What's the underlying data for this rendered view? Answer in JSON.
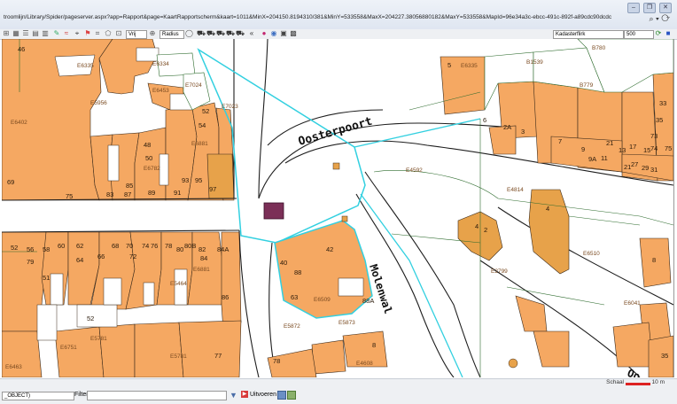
{
  "browser": {
    "url": "troomlijn/Library/Spider/pageserver.aspx?app=Rapport&page=KaartRapportscherm&kaart=1011&MinX=204150.8194310/381&MinY=533558&MaxX=204227.38056880182&MaxY=533558&MapId=96e34a3c-ebcc-491c-892f-a89cdc90dcdc",
    "nav_symbols": "⌕ ▾ ⟳"
  },
  "toolbar": {
    "select_vrij": "Vrij",
    "select_radius": "Radius",
    "select_layer": "Kadasterflirk",
    "select_scale": "500"
  },
  "map": {
    "street_names": [
      "Oosterpoort",
      "Molenwal",
      "Oo"
    ],
    "house_numbers": [
      "46",
      "69",
      "75",
      "83",
      "87",
      "85",
      "89",
      "91",
      "93",
      "95",
      "97",
      "48",
      "50",
      "52",
      "54",
      "56",
      "58",
      "60",
      "62",
      "64",
      "66",
      "68",
      "70",
      "72",
      "74",
      "76",
      "78",
      "80",
      "80B",
      "82",
      "84",
      "84A",
      "86",
      "63",
      "40",
      "42",
      "88",
      "88A",
      "8",
      "4",
      "2",
      "2A",
      "3",
      "5",
      "6",
      "7",
      "9",
      "9A",
      "11",
      "13",
      "15",
      "17",
      "21",
      "27",
      "29",
      "31",
      "33",
      "35",
      "73",
      "74",
      "75",
      "77",
      "78",
      "79",
      "51",
      "52",
      "56A",
      "58A",
      "E7097"
    ],
    "parcel_ids": [
      "E6334",
      "E6335",
      "E6402",
      "E5956",
      "E7024",
      "E7023",
      "E6453",
      "E6451",
      "E6783",
      "E4592",
      "E4814",
      "E6510",
      "E2799",
      "E6041",
      "E5872",
      "E5873",
      "E6509",
      "E4608",
      "E6951",
      "E6897",
      "E5781",
      "E6463",
      "E6751",
      "B780",
      "B1539",
      "B779",
      "E8874",
      "E6782",
      "E6785",
      "E6881",
      "E5460",
      "E5464",
      "E2783",
      "E6042"
    ]
  },
  "statusbar": {
    "object_select": "_OBJECT)",
    "filter_label": "Filter",
    "run_label": "Uitvoeren",
    "scale_label": "Schaal",
    "scale_value": "10 m"
  },
  "colors": {
    "parcel_fill": "#f5a862",
    "parcel_fill_dark": "#e7a24a",
    "selection_outline": "#33d0e0",
    "marker": "#7b2f57",
    "parcel_line": "#2d6b2d"
  }
}
